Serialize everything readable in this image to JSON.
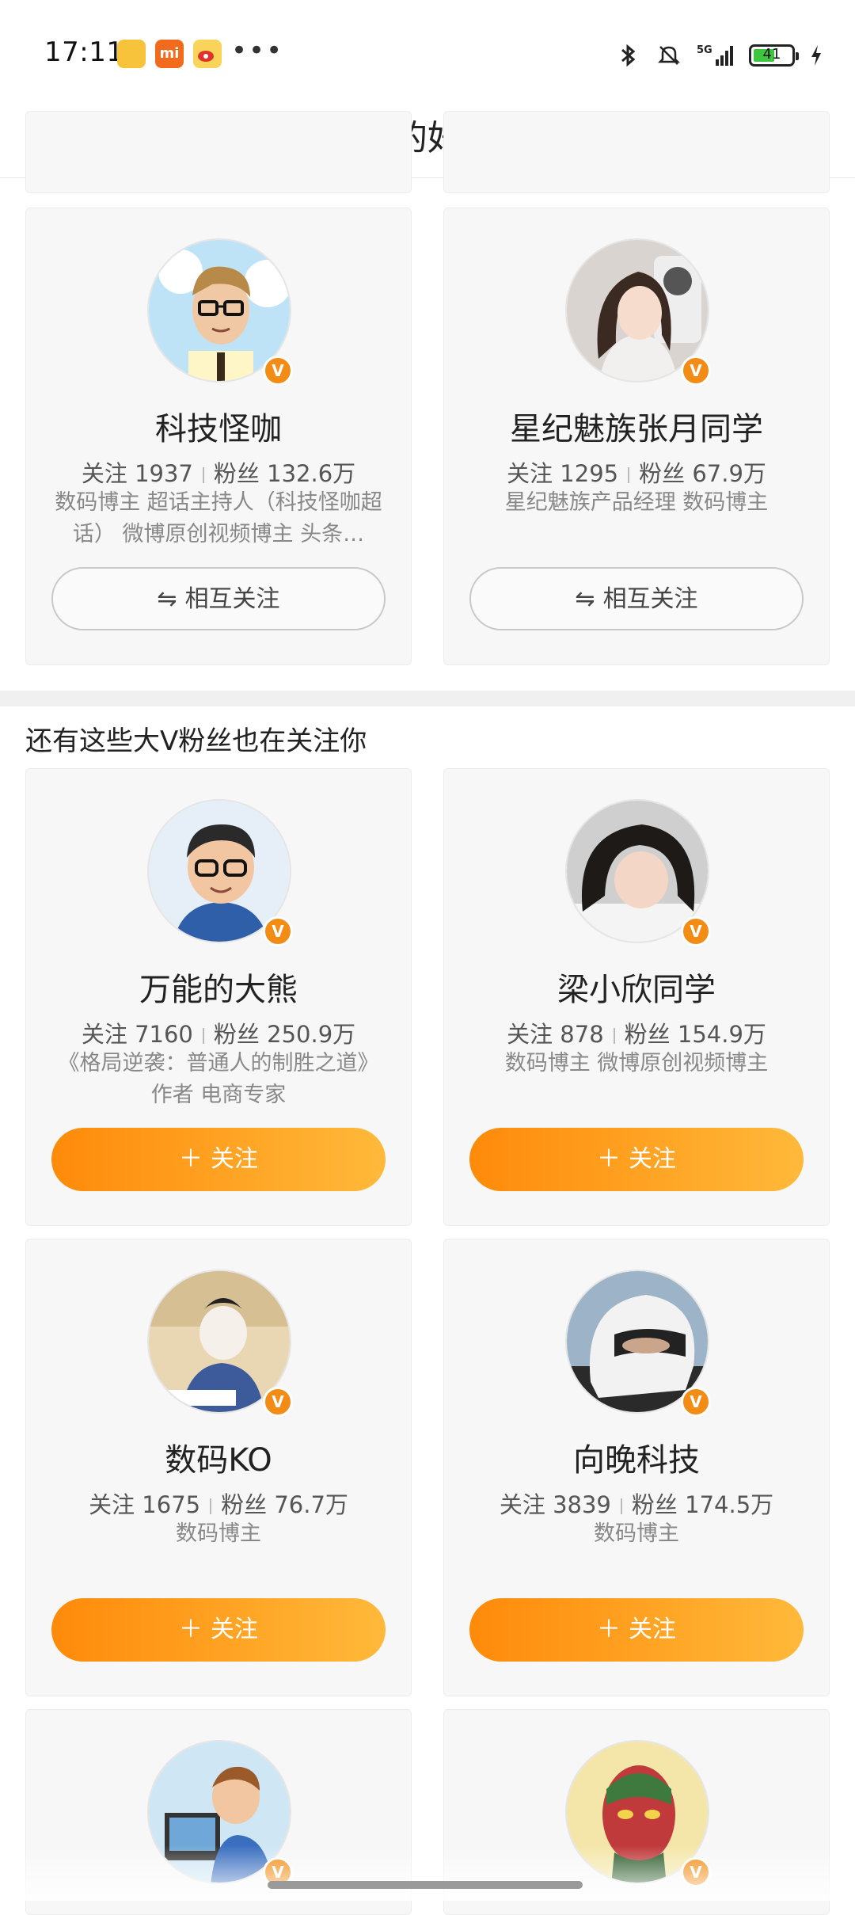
{
  "status_bar": {
    "time": "17:11",
    "mi_label": "mi",
    "battery": "41"
  },
  "header": {
    "title": "新的好友"
  },
  "mutual": [
    {
      "name": "科技怪咖",
      "follow_label": "关注",
      "follow": "1937",
      "fans_label": "粉丝",
      "fans": "132.6万",
      "bio": "数码博主 超话主持人（科技怪咖超话） 微博原创视频博主 头条…",
      "button": "相互关注",
      "avatar_icon": "cartoon-man-glasses-avatar"
    },
    {
      "name": "星纪魅族张月同学",
      "follow_label": "关注",
      "follow": "1295",
      "fans_label": "粉丝",
      "fans": "67.9万",
      "bio": "星纪魅族产品经理 数码博主",
      "button": "相互关注",
      "avatar_icon": "woman-photo-avatar"
    }
  ],
  "section": {
    "title": "还有这些大V粉丝也在关注你"
  },
  "suggested": [
    {
      "name": "万能的大熊",
      "follow_label": "关注",
      "follow": "7160",
      "fans_label": "粉丝",
      "fans": "250.9万",
      "bio": "《格局逆袭：普通人的制胜之道》作者 电商专家",
      "button": "关注",
      "avatar_icon": "3d-cartoon-man-avatar"
    },
    {
      "name": "梁小欣同学",
      "follow_label": "关注",
      "follow": "878",
      "fans_label": "粉丝",
      "fans": "154.9万",
      "bio": "数码博主 微博原创视频博主",
      "button": "关注",
      "avatar_icon": "woman-photo-avatar"
    },
    {
      "name": "数码KO",
      "follow_label": "关注",
      "follow": "1675",
      "fans_label": "粉丝",
      "fans": "76.7万",
      "bio": "数码博主",
      "button": "关注",
      "avatar_icon": "anime-writer-avatar"
    },
    {
      "name": "向晚科技",
      "follow_label": "关注",
      "follow": "3839",
      "fans_label": "粉丝",
      "fans": "174.5万",
      "bio": "数码博主",
      "button": "关注",
      "avatar_icon": "helmet-rider-avatar"
    }
  ],
  "verified_badge": "V",
  "colors": {
    "accent": "#ff8a0a",
    "accent_end": "#ffb93a",
    "badge": "#f28c14"
  }
}
